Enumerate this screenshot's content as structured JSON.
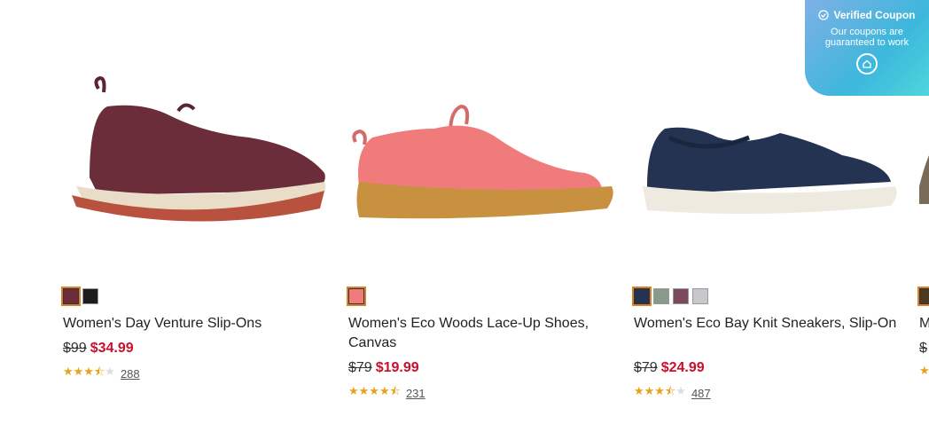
{
  "products": [
    {
      "name": "Women's Day Venture Slip-Ons",
      "price_original": "$99",
      "price_sale": "$34.99",
      "rating": 3.5,
      "review_count": "288",
      "swatches": [
        "#6b2d3a",
        "#1c1c1c"
      ]
    },
    {
      "name": "Women's Eco Woods Lace-Up Shoes, Canvas",
      "price_original": "$79",
      "price_sale": "$19.99",
      "rating": 4.5,
      "review_count": "231",
      "swatches": [
        "#f07b7b"
      ]
    },
    {
      "name": "Women's Eco Bay Knit Sneakers, Slip-On",
      "price_original": "$79",
      "price_sale": "$24.99",
      "rating": 3.5,
      "review_count": "487",
      "swatches": [
        "#243352",
        "#8a9a8a",
        "#7b4a5f",
        "#c8c8cc"
      ]
    },
    {
      "name": "M",
      "price_original": "$",
      "price_sale": "",
      "rating": 0,
      "review_count": "",
      "swatches": [
        "#4a3a24"
      ]
    }
  ],
  "coupon": {
    "title": "Verified Coupon",
    "line1": "Our coupons are",
    "line2": "guaranteed to work"
  },
  "icons": {
    "verified": "check-circle-icon",
    "coupon_action": "coupon-home-icon"
  }
}
